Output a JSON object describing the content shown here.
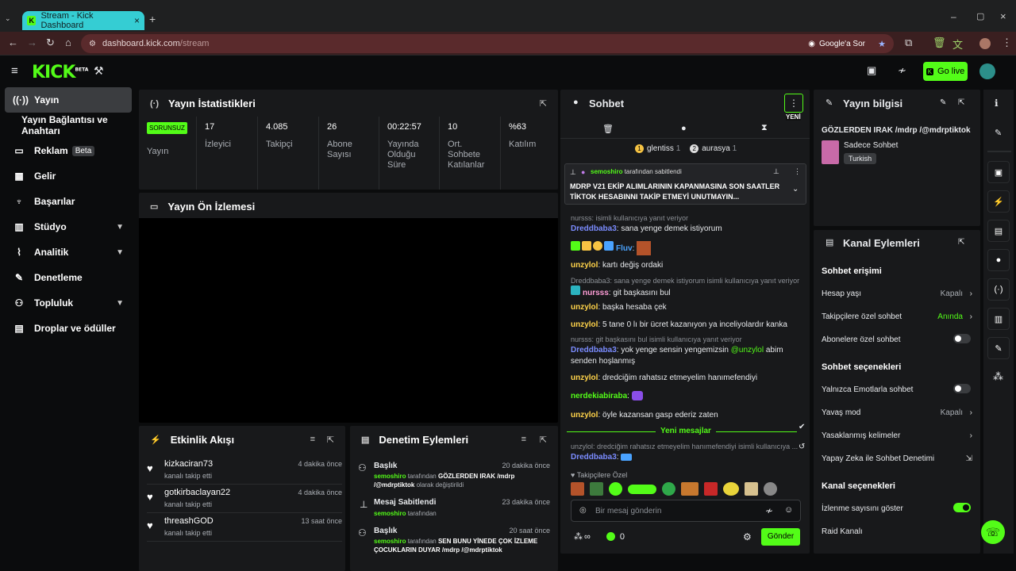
{
  "browser": {
    "tab_title": "Stream - Kick Dashboard",
    "url_host": "dashboard.kick.com",
    "url_path": "/stream",
    "google_ask": "Google'a Sor",
    "new_tab": "+"
  },
  "brand": {
    "logo": "KICK",
    "beta": "BETA",
    "accent": "#53fc18"
  },
  "topbar": {
    "golive": "Go live"
  },
  "sidebar": {
    "items": [
      {
        "label": "Yayın",
        "icon": "broadcast-icon"
      },
      {
        "label": "Yayın Bağlantısı ve Anahtarı"
      },
      {
        "label": "Reklam",
        "badge": "Beta",
        "icon": "ad-icon"
      },
      {
        "label": "Gelir",
        "icon": "revenue-icon"
      },
      {
        "label": "Başarılar",
        "icon": "trophy-icon"
      },
      {
        "label": "Stüdyo",
        "icon": "studio-icon"
      },
      {
        "label": "Analitik",
        "icon": "analytics-icon"
      },
      {
        "label": "Denetleme",
        "icon": "moderation-icon"
      },
      {
        "label": "Topluluk",
        "icon": "community-icon"
      },
      {
        "label": "Droplar ve ödüller",
        "icon": "drops-icon"
      }
    ]
  },
  "stats": {
    "title": "Yayın İstatistikleri",
    "status": "SORUNSUZ",
    "status_label": "Yayın",
    "items": [
      {
        "value": "17",
        "label": "İzleyici"
      },
      {
        "value": "4.085",
        "label": "Takipçi"
      },
      {
        "value": "26",
        "label": "Abone Sayısı"
      },
      {
        "value": "00:22:57",
        "label": "Yayında Olduğu Süre"
      },
      {
        "value": "10",
        "label": "Ort. Sohbete Katılanlar"
      },
      {
        "value": "%63",
        "label": "Katılım"
      }
    ]
  },
  "preview": {
    "title": "Yayın Ön İzlemesi"
  },
  "activity": {
    "title": "Etkinlik Akışı",
    "items": [
      {
        "name": "kizkaciran73",
        "sub": "kanalı takip etti",
        "time": "4 dakika önce"
      },
      {
        "name": "gotkirbaclayan22",
        "sub": "kanalı takip etti",
        "time": "4 dakika önce"
      },
      {
        "name": "threashGOD",
        "sub": "kanalı takip etti",
        "time": "13 saat önce"
      }
    ]
  },
  "modactions": {
    "title": "Denetim Eylemleri",
    "items": [
      {
        "title": "Başlık",
        "time": "20 dakika önce",
        "user": "semoshiro",
        "by": "tarafından",
        "bold": "GÖZLERDEN IRAK /mdrp /@mdrptiktok",
        "rest": "olarak değiştirildi"
      },
      {
        "title": "Mesaj Sabitlendi",
        "time": "23 dakika önce",
        "user": "semoshiro",
        "by": "tarafından",
        "bold": "",
        "rest": ""
      },
      {
        "title": "Başlık",
        "time": "20 saat önce",
        "user": "semoshiro",
        "by": "tarafından",
        "bold": "SEN BUNU YİNEDE ÇOK İZLEME ÇOCUKLARIN DUYAR /mdrp /@mdrptiktok",
        "rest": ""
      }
    ]
  },
  "chat": {
    "title": "Sohbet",
    "new_label": "YENİ",
    "top": [
      {
        "name": "glentiss",
        "rank": "1",
        "count": "1"
      },
      {
        "name": "aurasya",
        "rank": "2",
        "count": "1"
      }
    ],
    "pinned": {
      "user": "semoshiro",
      "by": "tarafından sabitlendi",
      "text": "MDRP V21 EKİP ALIMLARININ KAPANMASINA SON SAATLER TİKTOK HESABINNI TAKİP ETMEYİ UNUTMAYIN..."
    },
    "messages": [
      {
        "reply": "nursss: isimli kullanıcıya yanıt veriyor"
      },
      {
        "user": "Dreddbaba3",
        "color": "#7b8cff",
        "text": "sana yenge demek istiyorum"
      },
      {
        "user": "Fluv",
        "color": "#4aa3ff",
        "text": ""
      },
      {
        "user": "unzylol",
        "color": "#ffd34a",
        "text": "kartı değiş ordaki"
      },
      {
        "reply": "Dreddbaba3: sana yenge demek istiyorum isimli kullanıcıya yanıt veriyor"
      },
      {
        "user": "nursss",
        "color": "#ff9ed8",
        "text": "git başkasını bul"
      },
      {
        "user": "unzylol",
        "color": "#ffd34a",
        "text": "başka hesaba çek"
      },
      {
        "user": "unzylol",
        "color": "#ffd34a",
        "text": "5 tane 0 lı bir ücret kazanıyon ya inceliyolardır kanka"
      },
      {
        "reply": "nursss: git başkasını bul isimli kullanıcıya yanıt veriyor"
      },
      {
        "user": "Dreddbaba3",
        "color": "#7b8cff",
        "text": "yok yenge sensin yengemizsin",
        "mention": "@unzylol",
        "text2": "abim senden hoşlanmış"
      },
      {
        "user": "unzylol",
        "color": "#ffd34a",
        "text": "dredciğim rahatsız etmeyelim hanımefendiyi"
      },
      {
        "user": "nerdekiabiraba",
        "color": "#53fc18",
        "text": ""
      },
      {
        "user": "unzylol",
        "color": "#ffd34a",
        "text": "öyle kazansan gasp ederiz zaten"
      },
      {
        "reply": "unzylol: dredciğim rahatsız etmeyelim hanımefendiyi isimli kullanıcıya ..."
      },
      {
        "user": "Dreddbaba3",
        "color": "#7b8cff",
        "text": ""
      }
    ],
    "new_messages": "Yeni mesajlar",
    "followers_only": "Takipçilere Özel",
    "input_placeholder": "Bir mesaj gönderin",
    "infinity": "∞",
    "count": "0",
    "send": "Gönder"
  },
  "info": {
    "title": "Yayın bilgisi",
    "stream_title": "GÖZLERDEN IRAK /mdrp /@mdrptiktok",
    "category": "Sadece Sohbet",
    "lang": "Turkish"
  },
  "actions": {
    "title": "Kanal Eylemleri",
    "chat_access": "Sohbet erişimi",
    "account_age": {
      "label": "Hesap yaşı",
      "value": "Kapalı"
    },
    "followers": {
      "label": "Takipçilere özel sohbet",
      "value": "Anında"
    },
    "subs": {
      "label": "Abonelere özel sohbet"
    },
    "chat_opts": "Sohbet seçenekleri",
    "emotes": {
      "label": "Yalnızca Emotlarla sohbet"
    },
    "slow": {
      "label": "Yavaş mod",
      "value": "Kapalı"
    },
    "banned": {
      "label": "Yasaklanmış kelimeler"
    },
    "ai": {
      "label": "Yapay Zeka ile Sohbet Denetimi"
    },
    "channel_opts": "Kanal seçenekleri",
    "viewcount": {
      "label": "İzlenme sayısını göster"
    },
    "raid": {
      "label": "Raid Kanalı"
    }
  }
}
